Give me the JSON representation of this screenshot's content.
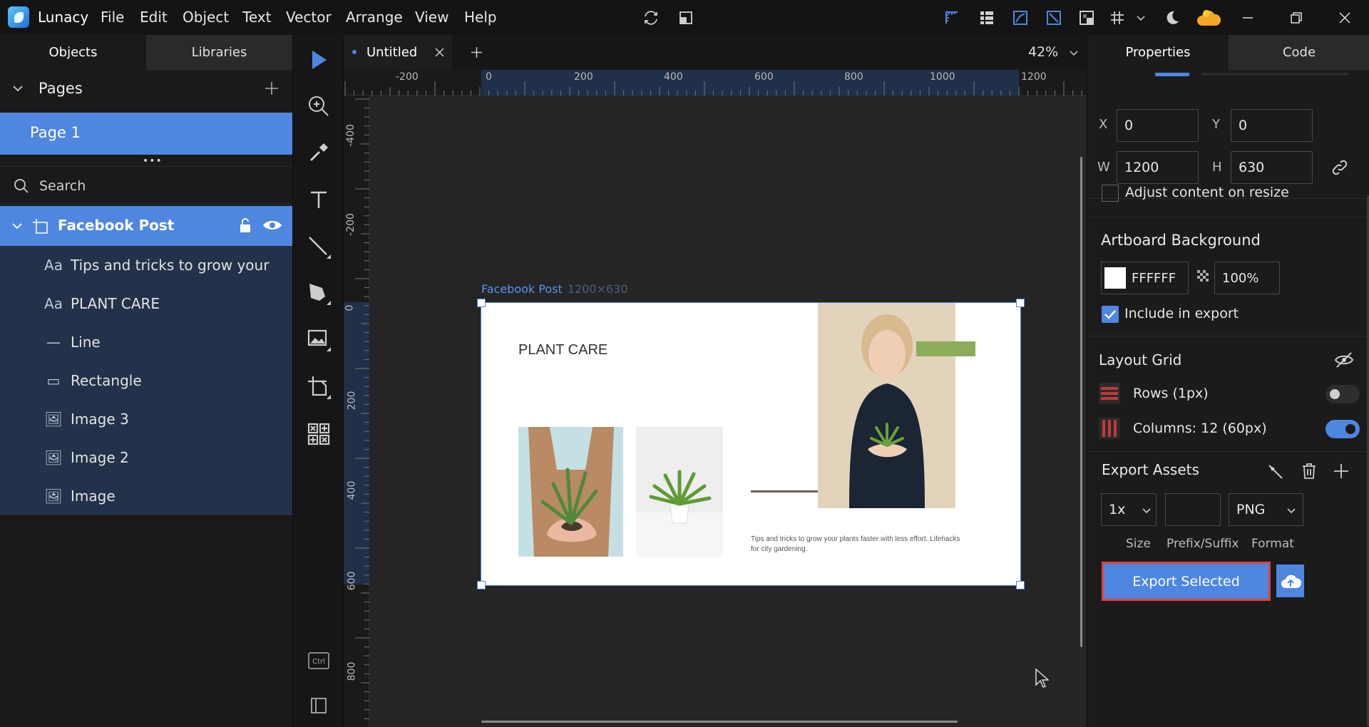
{
  "app": {
    "name": "Lunacy",
    "menu": [
      "File",
      "Edit",
      "Object",
      "Text",
      "Vector",
      "Arrange",
      "View",
      "Help"
    ]
  },
  "left_panel": {
    "tabs": [
      "Objects",
      "Libraries"
    ],
    "pages_header": "Pages",
    "pages": [
      "Page 1"
    ],
    "search_placeholder": "Search",
    "artboard": "Facebook Post",
    "layers": [
      {
        "icon": "text-layer-icon",
        "glyph": "Aa",
        "label": "Tips and tricks to grow your p"
      },
      {
        "icon": "text-layer-icon",
        "glyph": "Aa",
        "label": "PLANT CARE"
      },
      {
        "icon": "line-layer-icon",
        "glyph": "—",
        "label": "Line"
      },
      {
        "icon": "rectangle-layer-icon",
        "glyph": "▭",
        "label": "Rectangle"
      },
      {
        "icon": "image-layer-icon",
        "glyph": "🖼",
        "label": "Image 3"
      },
      {
        "icon": "image-layer-icon",
        "glyph": "🖼",
        "label": "Image 2"
      },
      {
        "icon": "image-layer-icon",
        "glyph": "🖼",
        "label": "Image"
      }
    ]
  },
  "document": {
    "tab_title": "Untitled",
    "zoom": "42%",
    "h_ruler": [
      "-200",
      "0",
      "200",
      "400",
      "600",
      "800",
      "1000",
      "1200"
    ],
    "v_ruler": [
      "-400",
      "-200",
      "0",
      "200",
      "400",
      "600",
      "800"
    ]
  },
  "artboard": {
    "name": "Facebook Post",
    "size": "1200×630",
    "heading": "PLANT CARE",
    "caption": "Tips and tricks to grow your plants faster with less effort. Lifehacks for city gardening.",
    "accent": "#8bad5b"
  },
  "properties": {
    "tabs": [
      "Properties",
      "Code"
    ],
    "x_label": "X",
    "x": "0",
    "y_label": "Y",
    "y": "0",
    "w_label": "W",
    "w": "1200",
    "h_label": "H",
    "h": "630",
    "adjust_label": "Adjust content on resize",
    "bg_title": "Artboard Background",
    "bg_color": "FFFFFF",
    "bg_opacity": "100%",
    "include_export": "Include in export",
    "layout_grid_title": "Layout Grid",
    "rows_label": "Rows (1px)",
    "rows_on": false,
    "columns_label": "Columns: 12 (60px)",
    "columns_on": true,
    "export_title": "Export Assets",
    "export_scale": "1x",
    "export_prefix": "",
    "export_format": "PNG",
    "size_label": "Size",
    "prefix_label": "Prefix/Suffix",
    "format_label": "Format",
    "export_button": "Export Selected"
  },
  "colors": {
    "accent": "#4f86e0",
    "selection": "#4f86e0",
    "export_border": "#e0443d"
  }
}
